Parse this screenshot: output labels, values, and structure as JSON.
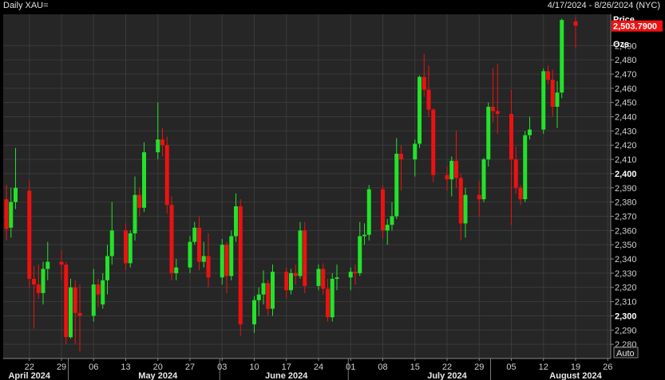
{
  "header": {
    "title": "Daily XAU=",
    "date_range": "4/17/2024 - 8/26/2024 (NYC)"
  },
  "axis_panel": {
    "price_label": "Price",
    "unit_label": "Ozs",
    "auto_button": "Auto"
  },
  "colors": {
    "background": "#000000",
    "plot_background": "#262626",
    "grid": "#3a3a3a",
    "up": "#22e22a",
    "down": "#ee1111",
    "text": "#d0d0d0"
  },
  "chart_data": {
    "type": "candlestick",
    "symbol": "XAU=",
    "interval": "Daily",
    "y_range": [
      2270,
      2512
    ],
    "y_ticks": [
      {
        "value": 2280,
        "label": "2,280"
      },
      {
        "value": 2290,
        "label": "2,290"
      },
      {
        "value": 2300,
        "label": "2,300",
        "major": true
      },
      {
        "value": 2310,
        "label": "2,310"
      },
      {
        "value": 2320,
        "label": "2,320"
      },
      {
        "value": 2330,
        "label": "2,330"
      },
      {
        "value": 2340,
        "label": "2,340"
      },
      {
        "value": 2350,
        "label": "2,350"
      },
      {
        "value": 2360,
        "label": "2,360"
      },
      {
        "value": 2370,
        "label": "2,370"
      },
      {
        "value": 2380,
        "label": "2,380"
      },
      {
        "value": 2390,
        "label": "2,390"
      },
      {
        "value": 2400,
        "label": "2,400",
        "major": true
      },
      {
        "value": 2410,
        "label": "2,410"
      },
      {
        "value": 2420,
        "label": "2,420"
      },
      {
        "value": 2430,
        "label": "2,430"
      },
      {
        "value": 2440,
        "label": "2,440"
      },
      {
        "value": 2450,
        "label": "2,450"
      },
      {
        "value": 2460,
        "label": "2,460"
      },
      {
        "value": 2470,
        "label": "2,470"
      },
      {
        "value": 2480,
        "label": "2,480"
      },
      {
        "value": 2490,
        "label": "2,490"
      }
    ],
    "last_price": {
      "value": 2503.79,
      "label": "2,503.7900"
    },
    "x_ticks": [
      {
        "date": "2024-04-22",
        "label": "22"
      },
      {
        "date": "2024-04-29",
        "label": "29"
      },
      {
        "date": "2024-05-06",
        "label": "06"
      },
      {
        "date": "2024-05-13",
        "label": "13"
      },
      {
        "date": "2024-05-20",
        "label": "20"
      },
      {
        "date": "2024-05-27",
        "label": "27"
      },
      {
        "date": "2024-06-03",
        "label": "03"
      },
      {
        "date": "2024-06-10",
        "label": "10"
      },
      {
        "date": "2024-06-17",
        "label": "17"
      },
      {
        "date": "2024-06-24",
        "label": "24"
      },
      {
        "date": "2024-07-01",
        "label": "01"
      },
      {
        "date": "2024-07-08",
        "label": "08"
      },
      {
        "date": "2024-07-15",
        "label": "15"
      },
      {
        "date": "2024-07-22",
        "label": "22"
      },
      {
        "date": "2024-07-29",
        "label": "29"
      },
      {
        "date": "2024-08-05",
        "label": "05"
      },
      {
        "date": "2024-08-12",
        "label": "12"
      },
      {
        "date": "2024-08-19",
        "label": "19"
      },
      {
        "date": "2024-08-26",
        "label": "26"
      }
    ],
    "month_labels": [
      {
        "date": "2024-04-22",
        "label": "April 2024"
      },
      {
        "date": "2024-05-20",
        "label": "May 2024"
      },
      {
        "date": "2024-06-17",
        "label": "June 2024"
      },
      {
        "date": "2024-07-22",
        "label": "July 2024"
      },
      {
        "date": "2024-08-19",
        "label": "August 2024"
      }
    ],
    "month_starts": [
      "2024-05-01",
      "2024-06-03",
      "2024-07-01",
      "2024-08-01"
    ],
    "candles": [
      {
        "date": "2024-04-17",
        "open": 2382,
        "high": 2392,
        "low": 2353,
        "close": 2361
      },
      {
        "date": "2024-04-18",
        "open": 2362,
        "high": 2390,
        "low": 2355,
        "close": 2380
      },
      {
        "date": "2024-04-19",
        "open": 2380,
        "high": 2418,
        "low": 2375,
        "close": 2390
      },
      {
        "date": "2024-04-22",
        "open": 2388,
        "high": 2395,
        "low": 2320,
        "close": 2326
      },
      {
        "date": "2024-04-23",
        "open": 2326,
        "high": 2335,
        "low": 2291,
        "close": 2322
      },
      {
        "date": "2024-04-24",
        "open": 2322,
        "high": 2336,
        "low": 2312,
        "close": 2316
      },
      {
        "date": "2024-04-25",
        "open": 2316,
        "high": 2338,
        "low": 2308,
        "close": 2333
      },
      {
        "date": "2024-04-26",
        "open": 2333,
        "high": 2352,
        "low": 2325,
        "close": 2338
      },
      {
        "date": "2024-04-29",
        "open": 2338,
        "high": 2346,
        "low": 2325,
        "close": 2336
      },
      {
        "date": "2024-04-30",
        "open": 2336,
        "high": 2338,
        "low": 2280,
        "close": 2285
      },
      {
        "date": "2024-05-01",
        "open": 2285,
        "high": 2326,
        "low": 2284,
        "close": 2320
      },
      {
        "date": "2024-05-02",
        "open": 2320,
        "high": 2325,
        "low": 2280,
        "close": 2302
      },
      {
        "date": "2024-05-03",
        "open": 2302,
        "high": 2322,
        "low": 2275,
        "close": 2300
      },
      {
        "date": "2024-05-06",
        "open": 2300,
        "high": 2333,
        "low": 2296,
        "close": 2322
      },
      {
        "date": "2024-05-07",
        "open": 2322,
        "high": 2326,
        "low": 2306,
        "close": 2315
      },
      {
        "date": "2024-05-08",
        "open": 2308,
        "high": 2330,
        "low": 2305,
        "close": 2325
      },
      {
        "date": "2024-05-09",
        "open": 2325,
        "high": 2350,
        "low": 2315,
        "close": 2342
      },
      {
        "date": "2024-05-10",
        "open": 2342,
        "high": 2380,
        "low": 2336,
        "close": 2360
      },
      {
        "date": "2024-05-13",
        "open": 2360,
        "high": 2365,
        "low": 2332,
        "close": 2337
      },
      {
        "date": "2024-05-14",
        "open": 2337,
        "high": 2360,
        "low": 2334,
        "close": 2358
      },
      {
        "date": "2024-05-15",
        "open": 2358,
        "high": 2398,
        "low": 2353,
        "close": 2385
      },
      {
        "date": "2024-05-16",
        "open": 2385,
        "high": 2390,
        "low": 2370,
        "close": 2376
      },
      {
        "date": "2024-05-17",
        "open": 2376,
        "high": 2422,
        "low": 2373,
        "close": 2415
      },
      {
        "date": "2024-05-20",
        "open": 2415,
        "high": 2450,
        "low": 2410,
        "close": 2424
      },
      {
        "date": "2024-05-21",
        "open": 2424,
        "high": 2432,
        "low": 2412,
        "close": 2420
      },
      {
        "date": "2024-05-22",
        "open": 2420,
        "high": 2426,
        "low": 2372,
        "close": 2378
      },
      {
        "date": "2024-05-23",
        "open": 2378,
        "high": 2384,
        "low": 2325,
        "close": 2330
      },
      {
        "date": "2024-05-24",
        "open": 2330,
        "high": 2340,
        "low": 2325,
        "close": 2334
      },
      {
        "date": "2024-05-27",
        "open": 2334,
        "high": 2356,
        "low": 2330,
        "close": 2352
      },
      {
        "date": "2024-05-28",
        "open": 2352,
        "high": 2366,
        "low": 2350,
        "close": 2362
      },
      {
        "date": "2024-05-29",
        "open": 2362,
        "high": 2370,
        "low": 2332,
        "close": 2338
      },
      {
        "date": "2024-05-30",
        "open": 2338,
        "high": 2352,
        "low": 2334,
        "close": 2342
      },
      {
        "date": "2024-05-31",
        "open": 2342,
        "high": 2358,
        "low": 2320,
        "close": 2327
      },
      {
        "date": "2024-06-03",
        "open": 2327,
        "high": 2354,
        "low": 2322,
        "close": 2350
      },
      {
        "date": "2024-06-04",
        "open": 2350,
        "high": 2352,
        "low": 2316,
        "close": 2328
      },
      {
        "date": "2024-06-05",
        "open": 2328,
        "high": 2360,
        "low": 2325,
        "close": 2356
      },
      {
        "date": "2024-06-06",
        "open": 2356,
        "high": 2386,
        "low": 2352,
        "close": 2377
      },
      {
        "date": "2024-06-07",
        "open": 2377,
        "high": 2382,
        "low": 2286,
        "close": 2294
      },
      {
        "date": "2024-06-10",
        "open": 2294,
        "high": 2314,
        "low": 2288,
        "close": 2311
      },
      {
        "date": "2024-06-11",
        "open": 2311,
        "high": 2320,
        "low": 2300,
        "close": 2315
      },
      {
        "date": "2024-06-12",
        "open": 2315,
        "high": 2332,
        "low": 2308,
        "close": 2323
      },
      {
        "date": "2024-06-13",
        "open": 2323,
        "high": 2325,
        "low": 2300,
        "close": 2305
      },
      {
        "date": "2024-06-14",
        "open": 2305,
        "high": 2336,
        "low": 2300,
        "close": 2331
      },
      {
        "date": "2024-06-17",
        "open": 2331,
        "high": 2334,
        "low": 2312,
        "close": 2318
      },
      {
        "date": "2024-06-18",
        "open": 2318,
        "high": 2333,
        "low": 2315,
        "close": 2330
      },
      {
        "date": "2024-06-19",
        "open": 2330,
        "high": 2336,
        "low": 2322,
        "close": 2328
      },
      {
        "date": "2024-06-20",
        "open": 2328,
        "high": 2366,
        "low": 2326,
        "close": 2360
      },
      {
        "date": "2024-06-21",
        "open": 2360,
        "high": 2366,
        "low": 2316,
        "close": 2321
      },
      {
        "date": "2024-06-24",
        "open": 2321,
        "high": 2336,
        "low": 2318,
        "close": 2333
      },
      {
        "date": "2024-06-25",
        "open": 2333,
        "high": 2337,
        "low": 2315,
        "close": 2319
      },
      {
        "date": "2024-06-26",
        "open": 2319,
        "high": 2326,
        "low": 2296,
        "close": 2299
      },
      {
        "date": "2024-06-27",
        "open": 2299,
        "high": 2330,
        "low": 2296,
        "close": 2326
      },
      {
        "date": "2024-06-28",
        "open": 2326,
        "high": 2336,
        "low": 2318,
        "close": 2327
      },
      {
        "date": "2024-07-01",
        "open": 2327,
        "high": 2334,
        "low": 2318,
        "close": 2331
      },
      {
        "date": "2024-07-02",
        "open": 2331,
        "high": 2336,
        "low": 2322,
        "close": 2330
      },
      {
        "date": "2024-07-03",
        "open": 2330,
        "high": 2366,
        "low": 2328,
        "close": 2356
      },
      {
        "date": "2024-07-04",
        "open": 2356,
        "high": 2365,
        "low": 2350,
        "close": 2357
      },
      {
        "date": "2024-07-05",
        "open": 2357,
        "high": 2392,
        "low": 2353,
        "close": 2389
      },
      {
        "date": "2024-07-08",
        "open": 2389,
        "high": 2392,
        "low": 2354,
        "close": 2360
      },
      {
        "date": "2024-07-09",
        "open": 2360,
        "high": 2368,
        "low": 2350,
        "close": 2364
      },
      {
        "date": "2024-07-10",
        "open": 2364,
        "high": 2380,
        "low": 2360,
        "close": 2370
      },
      {
        "date": "2024-07-11",
        "open": 2370,
        "high": 2425,
        "low": 2368,
        "close": 2414
      },
      {
        "date": "2024-07-12",
        "open": 2414,
        "high": 2420,
        "low": 2388,
        "close": 2410
      },
      {
        "date": "2024-07-15",
        "open": 2410,
        "high": 2424,
        "low": 2398,
        "close": 2421
      },
      {
        "date": "2024-07-16",
        "open": 2421,
        "high": 2469,
        "low": 2418,
        "close": 2468
      },
      {
        "date": "2024-07-17",
        "open": 2468,
        "high": 2484,
        "low": 2454,
        "close": 2459
      },
      {
        "date": "2024-07-18",
        "open": 2459,
        "high": 2476,
        "low": 2440,
        "close": 2445
      },
      {
        "date": "2024-07-19",
        "open": 2445,
        "high": 2446,
        "low": 2394,
        "close": 2399
      },
      {
        "date": "2024-07-22",
        "open": 2399,
        "high": 2405,
        "low": 2388,
        "close": 2396
      },
      {
        "date": "2024-07-23",
        "open": 2396,
        "high": 2412,
        "low": 2384,
        "close": 2409
      },
      {
        "date": "2024-07-24",
        "open": 2409,
        "high": 2430,
        "low": 2390,
        "close": 2397
      },
      {
        "date": "2024-07-25",
        "open": 2397,
        "high": 2400,
        "low": 2353,
        "close": 2365
      },
      {
        "date": "2024-07-26",
        "open": 2365,
        "high": 2390,
        "low": 2355,
        "close": 2385
      },
      {
        "date": "2024-07-29",
        "open": 2385,
        "high": 2395,
        "low": 2370,
        "close": 2382
      },
      {
        "date": "2024-07-30",
        "open": 2382,
        "high": 2411,
        "low": 2380,
        "close": 2410
      },
      {
        "date": "2024-07-31",
        "open": 2410,
        "high": 2450,
        "low": 2405,
        "close": 2447
      },
      {
        "date": "2024-08-01",
        "open": 2447,
        "high": 2474,
        "low": 2436,
        "close": 2444
      },
      {
        "date": "2024-08-02",
        "open": 2444,
        "high": 2477,
        "low": 2428,
        "close": 2442
      },
      {
        "date": "2024-08-05",
        "open": 2442,
        "high": 2459,
        "low": 2364,
        "close": 2410
      },
      {
        "date": "2024-08-06",
        "open": 2410,
        "high": 2419,
        "low": 2386,
        "close": 2390
      },
      {
        "date": "2024-08-07",
        "open": 2390,
        "high": 2392,
        "low": 2378,
        "close": 2382
      },
      {
        "date": "2024-08-08",
        "open": 2382,
        "high": 2430,
        "low": 2380,
        "close": 2427
      },
      {
        "date": "2024-08-09",
        "open": 2427,
        "high": 2440,
        "low": 2424,
        "close": 2431
      },
      {
        "date": "2024-08-12",
        "open": 2431,
        "high": 2474,
        "low": 2428,
        "close": 2472
      },
      {
        "date": "2024-08-13",
        "open": 2472,
        "high": 2476,
        "low": 2463,
        "close": 2466
      },
      {
        "date": "2024-08-14",
        "open": 2466,
        "high": 2473,
        "low": 2440,
        "close": 2447
      },
      {
        "date": "2024-08-15",
        "open": 2447,
        "high": 2465,
        "low": 2432,
        "close": 2457
      },
      {
        "date": "2024-08-16",
        "open": 2457,
        "high": 2509,
        "low": 2453,
        "close": 2508
      },
      {
        "date": "2024-08-19",
        "open": 2507,
        "high": 2510,
        "low": 2488,
        "close": 2504
      }
    ]
  }
}
